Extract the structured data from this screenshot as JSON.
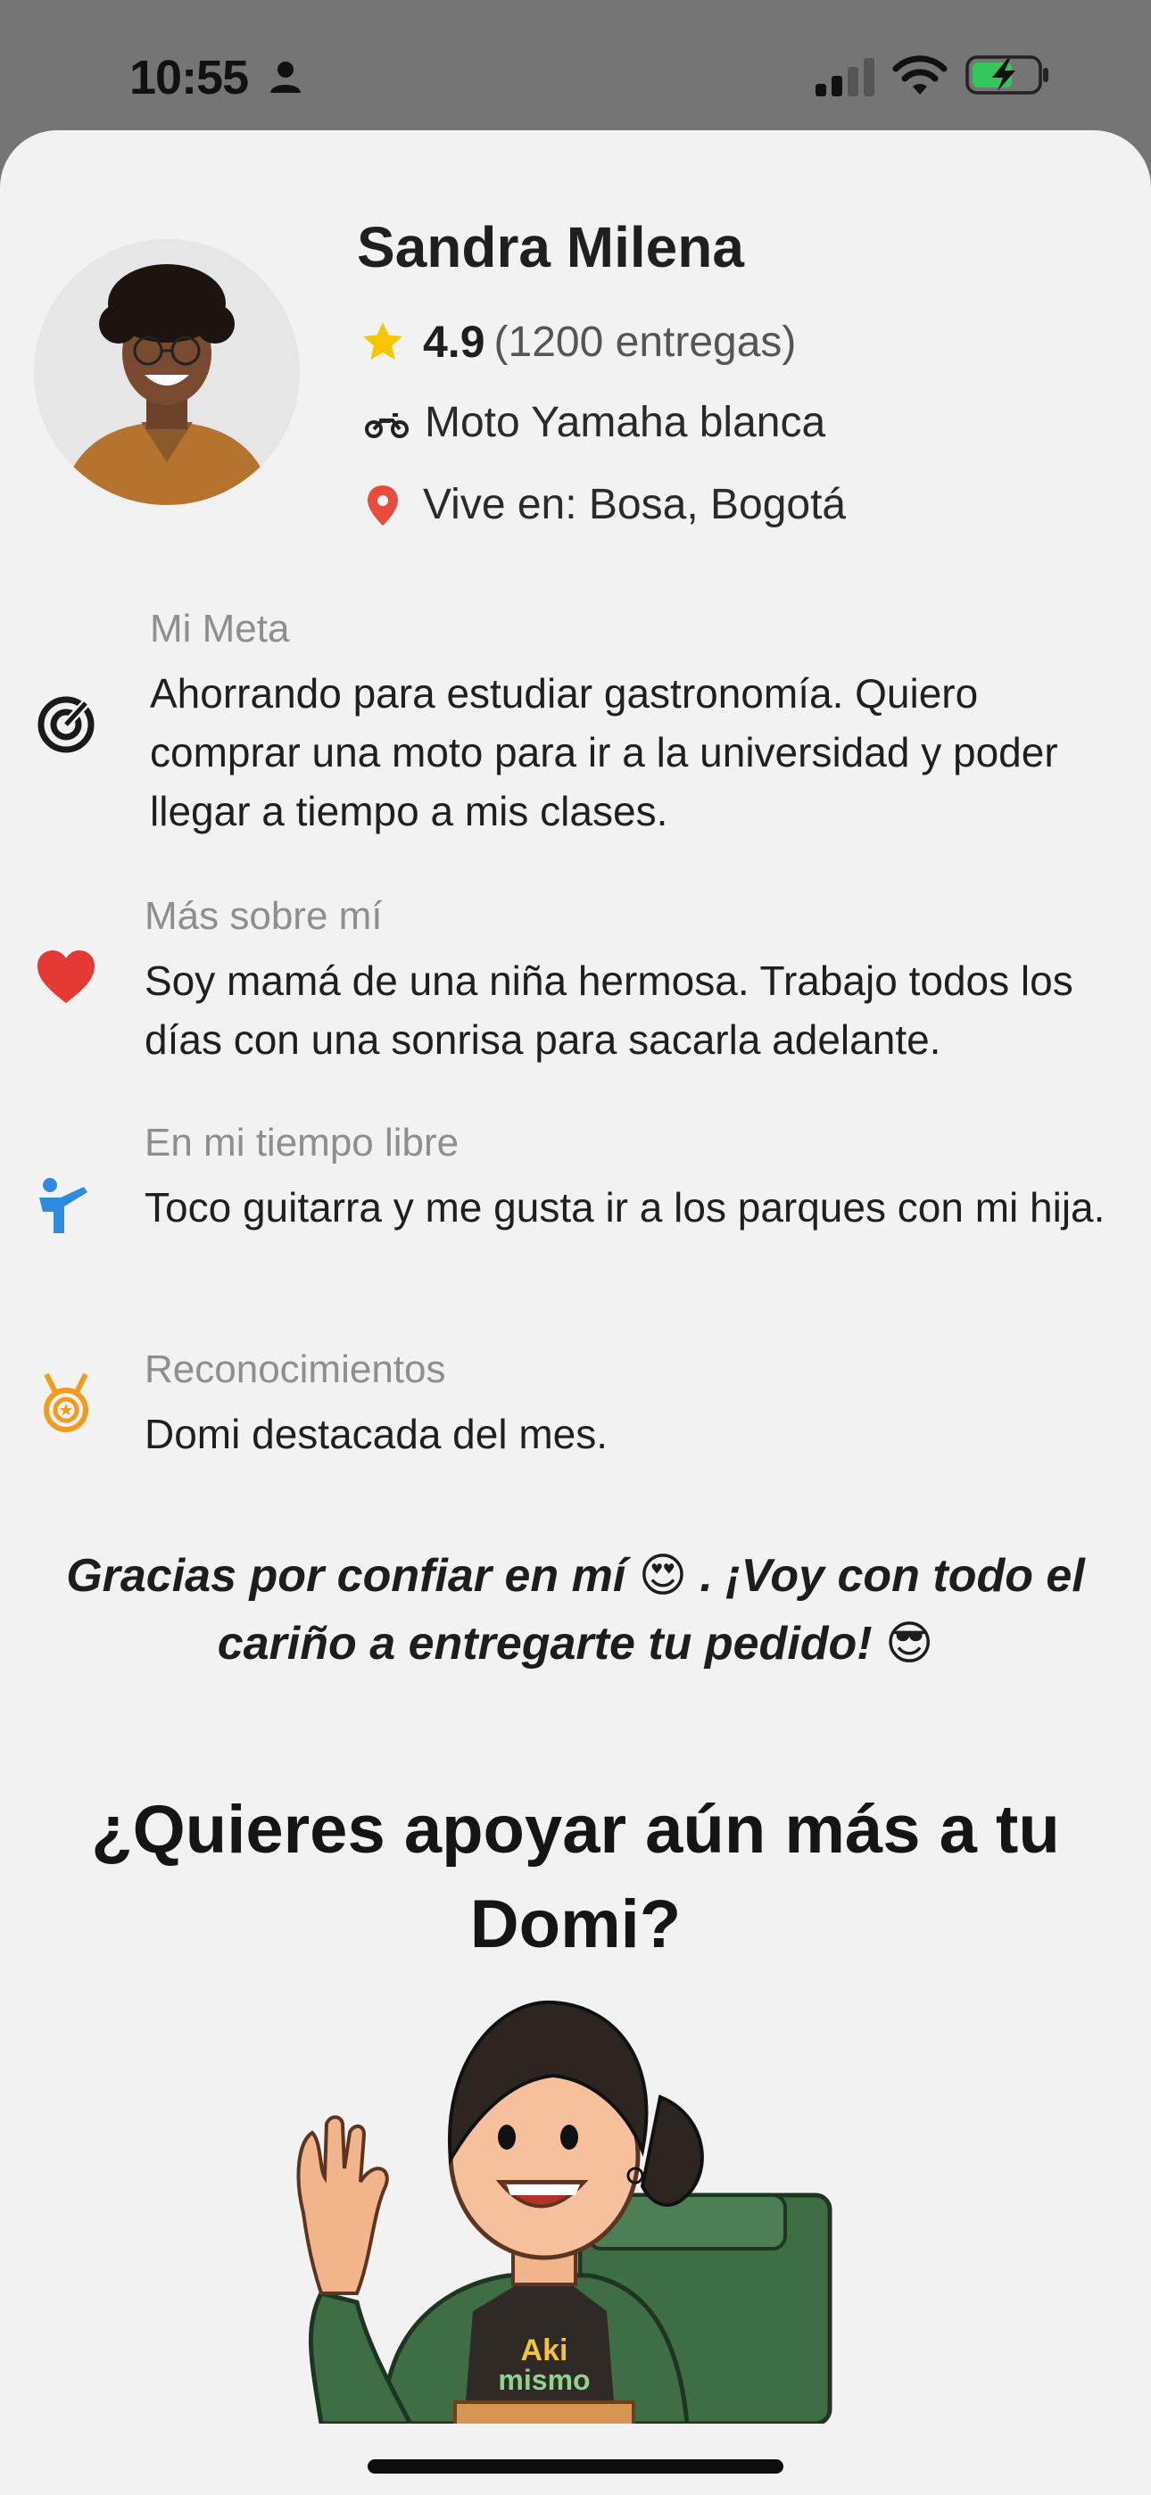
{
  "status_bar": {
    "time": "10:55"
  },
  "profile": {
    "name": "Sandra Milena",
    "rating": "4.9",
    "deliveries": "(1200 entregas)",
    "vehicle": "Moto Yamaha blanca",
    "location": "Vive en: Bosa, Bogotá"
  },
  "sections": [
    {
      "title": "Mi Meta",
      "text": "Ahorrando para estudiar gastronomía. Quiero comprar una moto para ir a la universidad y poder llegar a tiempo a mis clases.",
      "icon": "target-icon"
    },
    {
      "title": "Más sobre mí",
      "text": "Soy mamá de una niña hermosa. Trabajo todos los días con una sonrisa para sacarla adelante.",
      "icon": "heart-icon"
    },
    {
      "title": "En mi tiempo libre",
      "text": "Toco guitarra y me gusta ir a los parques con mi hija.",
      "icon": "leisure-icon"
    },
    {
      "title": "Reconocimientos",
      "text": "Domi destacada del mes.",
      "icon": "medal-icon"
    }
  ],
  "thanks": "Gracias por confiar en mí 😍 . ¡Voy con todo el cariño a entregarte tu pedido! 😎",
  "cta_title": "¿Quieres apoyar aún más a tu Domi?",
  "illustration": {
    "bag_text_1": "Aki",
    "bag_text_2": "mismo"
  },
  "colors": {
    "accent_green": "#3f6e45",
    "heart_red": "#e53935",
    "pin_red": "#e84c3d",
    "star_yellow": "#f7c600",
    "leisure_blue": "#2f8be0",
    "medal_orange": "#f29b1d"
  }
}
